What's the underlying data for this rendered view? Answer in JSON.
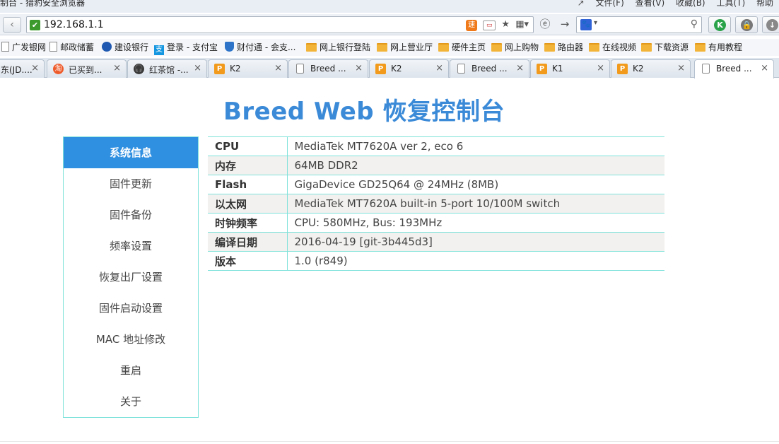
{
  "browser": {
    "window_title": "制台 - 猎豹安全浏览器",
    "menus": [
      "文件(F)",
      "查看(V)",
      "收藏(B)",
      "工具(T)",
      "帮助"
    ],
    "address": "192.168.1.1",
    "bookmarks": [
      {
        "label": "广发银网",
        "icon": "page-icon"
      },
      {
        "label": "邮政储蓄",
        "icon": "page-icon"
      },
      {
        "label": "建设银行",
        "icon": "ccb-icon"
      },
      {
        "label": "登录 - 支付宝",
        "icon": "alipay-icon"
      },
      {
        "label": "财付通 - 会支...",
        "icon": "shield-icon"
      },
      {
        "label": "网上银行登陆",
        "icon": "folder-icon"
      },
      {
        "label": "网上营业厅",
        "icon": "folder-icon"
      },
      {
        "label": "硬件主页",
        "icon": "folder-icon"
      },
      {
        "label": "网上购物",
        "icon": "folder-icon"
      },
      {
        "label": "路由器",
        "icon": "folder-icon"
      },
      {
        "label": "在线视频",
        "icon": "folder-icon"
      },
      {
        "label": "下载资源",
        "icon": "folder-icon"
      },
      {
        "label": "有用教程",
        "icon": "folder-icon"
      }
    ],
    "tabs": [
      {
        "label": "东(JD....",
        "icon": "page-icon"
      },
      {
        "label": "已买到...",
        "icon": "taobao-icon"
      },
      {
        "label": "红茶馆 -...",
        "icon": "headphone-icon"
      },
      {
        "label": "K2",
        "icon": "k-icon"
      },
      {
        "label": "Breed ...",
        "icon": "page-icon"
      },
      {
        "label": "K2",
        "icon": "k-icon"
      },
      {
        "label": "Breed ...",
        "icon": "page-icon"
      },
      {
        "label": "K1",
        "icon": "k-icon"
      },
      {
        "label": "K2",
        "icon": "k-icon"
      },
      {
        "label": "Breed ...",
        "icon": "page-icon",
        "active": true
      }
    ]
  },
  "page": {
    "title": "Breed Web 恢复控制台",
    "sidebar": [
      {
        "label": "系统信息",
        "active": true
      },
      {
        "label": "固件更新"
      },
      {
        "label": "固件备份"
      },
      {
        "label": "频率设置"
      },
      {
        "label": "恢复出厂设置"
      },
      {
        "label": "固件启动设置"
      },
      {
        "label": "MAC 地址修改"
      },
      {
        "label": "重启"
      },
      {
        "label": "关于"
      }
    ],
    "info": [
      {
        "key": "CPU",
        "value": "MediaTek MT7620A ver 2, eco 6"
      },
      {
        "key": "内存",
        "value": "64MB DDR2"
      },
      {
        "key": "Flash",
        "value": "GigaDevice GD25Q64 @ 24MHz (8MB)"
      },
      {
        "key": "以太网",
        "value": "MediaTek MT7620A built-in 5-port 10/100M switch"
      },
      {
        "key": "时钟频率",
        "value": "CPU: 580MHz, Bus: 193MHz"
      },
      {
        "key": "编译日期",
        "value": "2016-04-19 [git-3b445d3]"
      },
      {
        "key": "版本",
        "value": "1.0 (r849)"
      }
    ]
  }
}
